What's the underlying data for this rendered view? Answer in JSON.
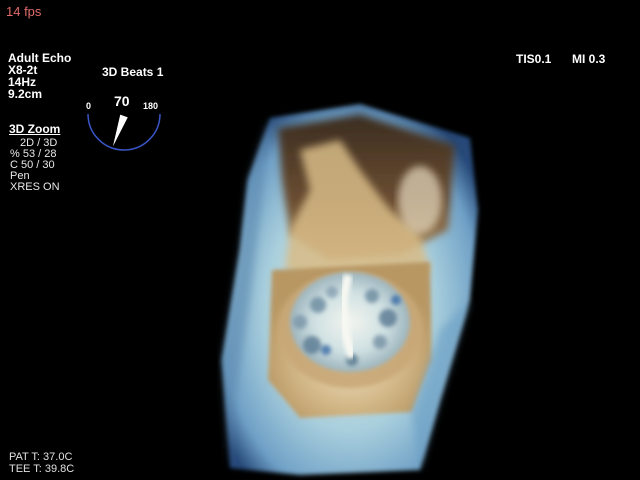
{
  "status": {
    "fps": "14 fps"
  },
  "probe": {
    "lines": [
      "Adult Echo",
      "X8-2t",
      "14Hz",
      "9.2cm"
    ]
  },
  "mode": {
    "beats": "3D Beats 1"
  },
  "dial": {
    "min_label": "0",
    "max_label": "180",
    "value_label": "70",
    "angle_value": 70,
    "angle_max": 180
  },
  "zoom": {
    "title": "3D Zoom",
    "lines": [
      "2D / 3D",
      "% 53 / 28",
      "C  50 / 30",
      "Pen",
      "XRES ON"
    ]
  },
  "indices": {
    "tis": "TIS0.1",
    "mi": "MI 0.3"
  },
  "temperature": {
    "pat": "PAT T: 37.0C",
    "tee": "TEE T: 39.8C"
  },
  "colors": {
    "background": "#000000",
    "text": "#ffffff",
    "fps": "#e06a6a",
    "dial_arc": "#3a55c8",
    "tissue_light": "#cfe7ea",
    "tissue_blue": "#7fb4d6",
    "tissue_brown": "#6b4a2e",
    "tissue_tan": "#c9a877"
  },
  "icons": {
    "dial": "probe-angle-dial-icon"
  }
}
